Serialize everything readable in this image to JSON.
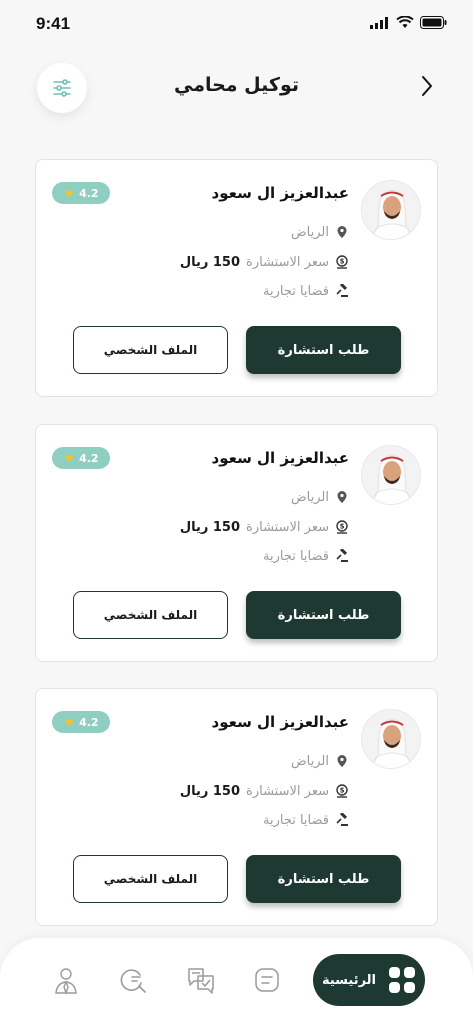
{
  "status_bar": {
    "time": "9:41"
  },
  "header": {
    "title": "توكيل محامي"
  },
  "lawyers": [
    {
      "name": "عبدالعزيز ال سعود",
      "rating": "4.2",
      "location": "الرياض",
      "price_label": "سعر الاستشارة",
      "price_value": "150 ريال",
      "case_type": "قضايا تجارية",
      "consult_label": "طلب استشارة",
      "profile_label": "الملف الشخصي"
    },
    {
      "name": "عبدالعزيز ال سعود",
      "rating": "4.2",
      "location": "الرياض",
      "price_label": "سعر الاستشارة",
      "price_value": "150 ريال",
      "case_type": "قضايا تجارية",
      "consult_label": "طلب استشارة",
      "profile_label": "الملف الشخصي"
    },
    {
      "name": "عبدالعزيز ال سعود",
      "rating": "4.2",
      "location": "الرياض",
      "price_label": "سعر الاستشارة",
      "price_value": "150 ريال",
      "case_type": "قضايا تجارية",
      "consult_label": "طلب استشارة",
      "profile_label": "الملف الشخصي"
    }
  ],
  "bottom_nav": {
    "active_label": "الرئيسية",
    "items": [
      "grid-icon",
      "document-icon",
      "chat-check-icon",
      "search-icon",
      "lawyer-icon"
    ]
  },
  "colors": {
    "primary": "#1e3932",
    "badge": "#8fcfc2",
    "star": "#f5c518"
  }
}
